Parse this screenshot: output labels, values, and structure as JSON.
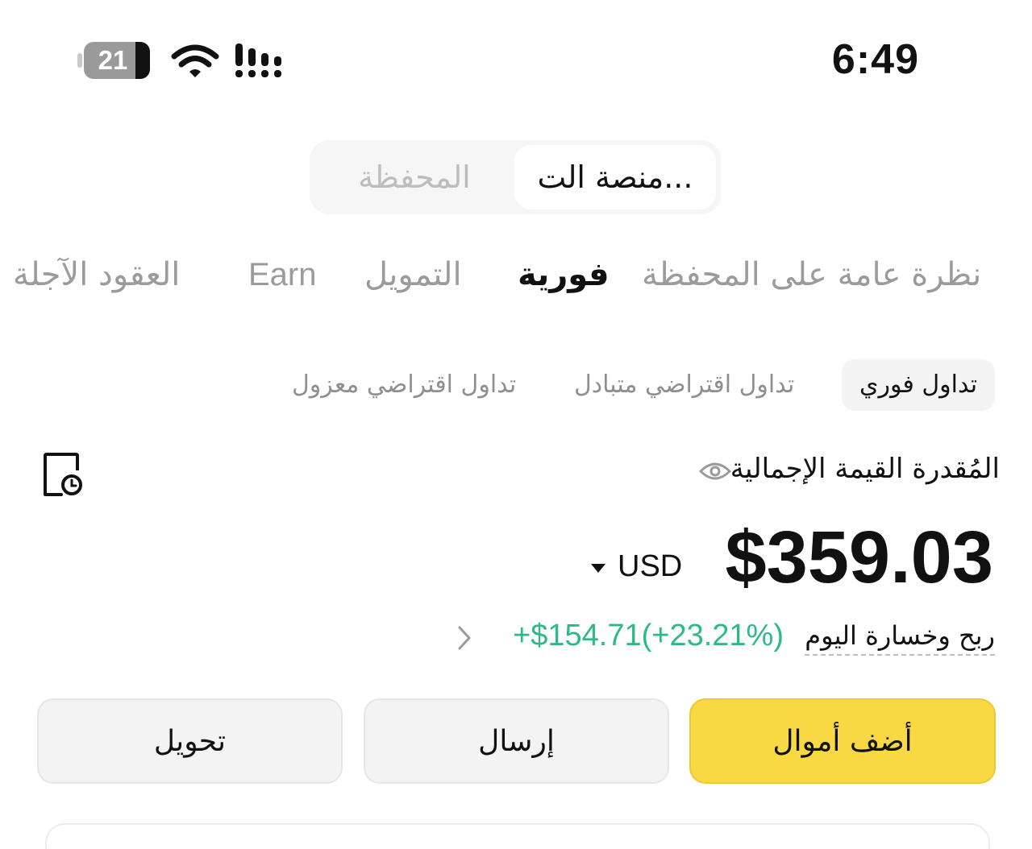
{
  "status_bar": {
    "battery_percent": 21,
    "time": "6:49"
  },
  "platform_switch": {
    "exchange_label": "منصة الت...",
    "wallet_label": "المحفظة",
    "active": "exchange"
  },
  "main_tabs": [
    {
      "label": "نظرة عامة على المحفظة",
      "active": false
    },
    {
      "label": "فورية",
      "active": true
    },
    {
      "label": "التمويل",
      "active": false
    },
    {
      "label": "Earn",
      "active": false
    },
    {
      "label": "العقود الآجلة",
      "active": false
    }
  ],
  "sub_tabs": [
    {
      "label": "تداول فوري",
      "active": true
    },
    {
      "label": "تداول اقتراضي متبادل",
      "active": false
    },
    {
      "label": "تداول اقتراضي معزول",
      "active": false
    }
  ],
  "wallet": {
    "estimated_label": "المُقدرة القيمة الإجمالية",
    "balance": "$359.03",
    "currency": "USD",
    "today_pnl_label": "ربح وخسارة اليوم",
    "today_pnl_change": "+$154.71(+23.21%)",
    "pnl_color": "#2fb98a"
  },
  "actions": {
    "add_funds": "أضف أموال",
    "send": "إرسال",
    "transfer": "تحويل"
  },
  "colors": {
    "accent": "#f8d843",
    "positive": "#2fb98a"
  }
}
